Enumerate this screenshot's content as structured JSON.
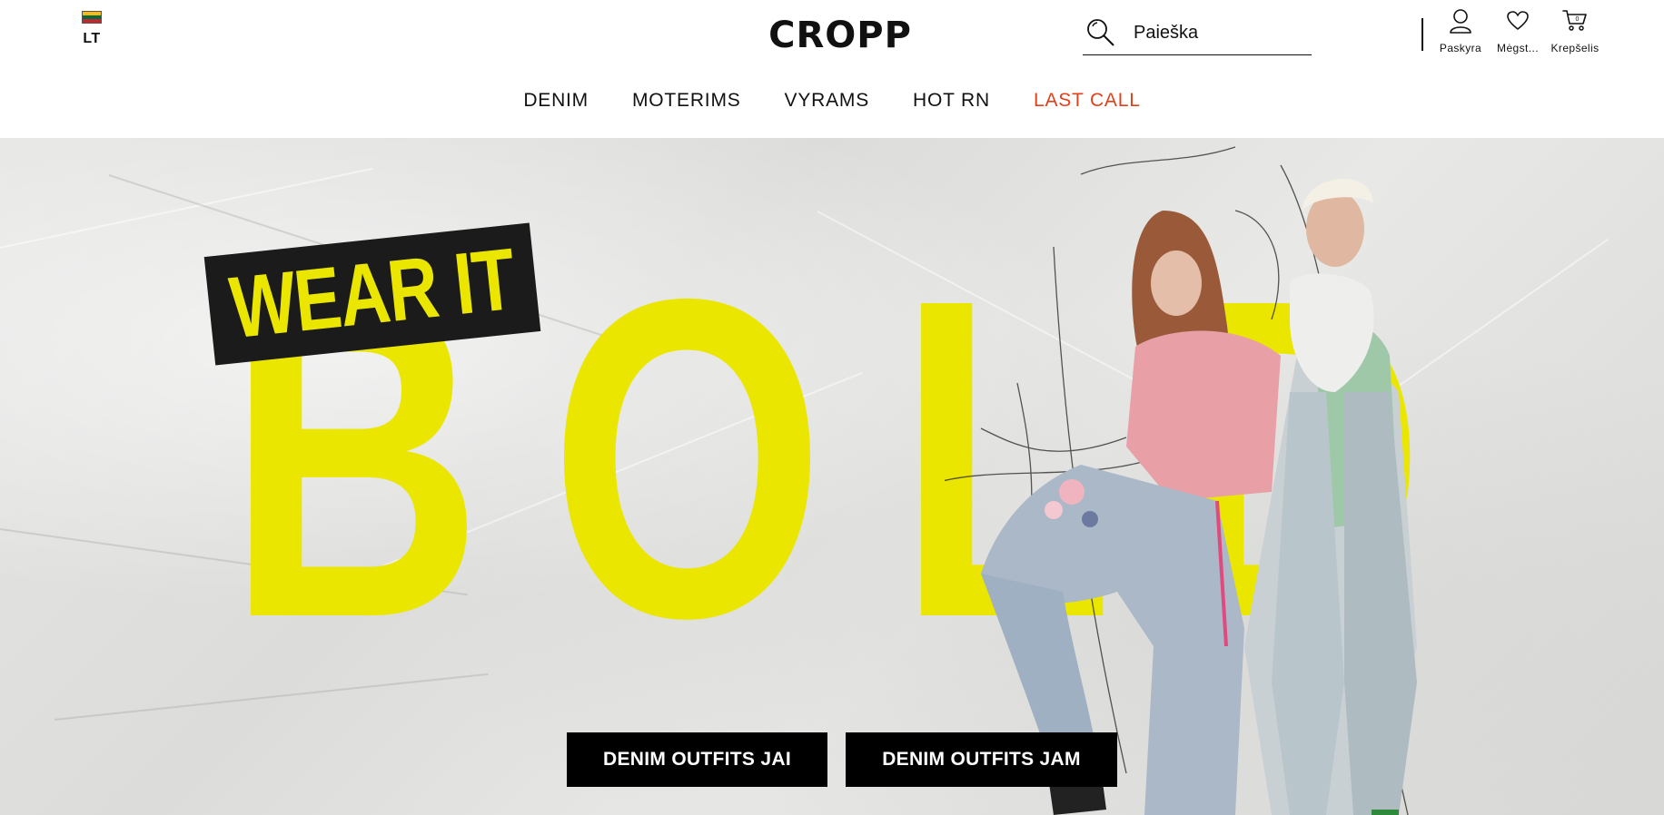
{
  "header": {
    "country_code": "LT",
    "logo_text": "CROPP",
    "search_placeholder": "Paieška",
    "actions": [
      {
        "label": "Paskyra",
        "icon": "user-icon"
      },
      {
        "label": "Mėgst...",
        "icon": "heart-icon"
      },
      {
        "label": "Krepšelis",
        "icon": "cart-icon",
        "count": "0"
      }
    ]
  },
  "nav": {
    "items": [
      {
        "label": "DENIM"
      },
      {
        "label": "MOTERIMS"
      },
      {
        "label": "VYRAMS"
      },
      {
        "label": "HOT RN"
      },
      {
        "label": "LAST CALL",
        "highlight": true
      }
    ]
  },
  "hero": {
    "tag_text": "WEAR IT",
    "headline_letters": [
      "B",
      "O",
      "L",
      "D"
    ],
    "buttons": [
      {
        "label": "DENIM OUTFITS JAI"
      },
      {
        "label": "DENIM OUTFITS JAM"
      }
    ]
  },
  "colors": {
    "accent_yellow": "#ebe600",
    "last_call_red": "#e0401a",
    "flag_yellow": "#fdb913",
    "flag_green": "#006a44",
    "flag_red": "#c1272d"
  }
}
